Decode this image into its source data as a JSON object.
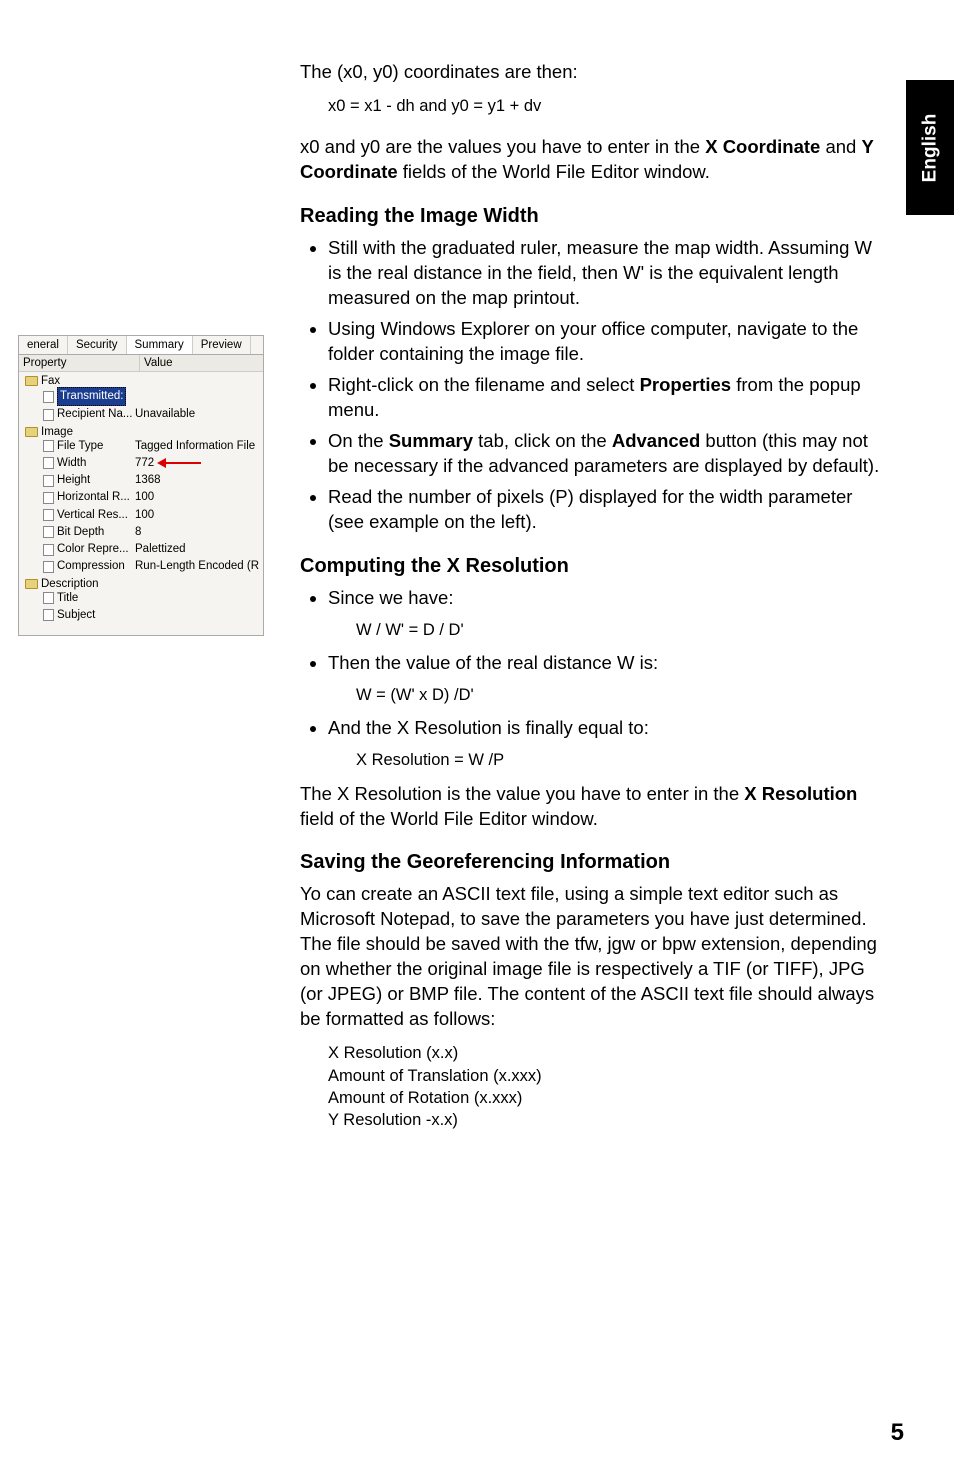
{
  "side_tab": "English",
  "intro": {
    "line1": "The (x0, y0) coordinates are then:",
    "formula": "x0 = x1 - dh and y0 = y1 + dv",
    "para2a": "x0 and y0 are the values you have to enter in the ",
    "para2b": "X Coordinate",
    "para2c": " and ",
    "para2d": "Y Coordinate",
    "para2e": " fields of the World File Editor window."
  },
  "reading": {
    "title": "Reading the Image Width",
    "b1": "Still with the graduated ruler, measure the map width. Assuming W is the real distance in the field, then W' is the equivalent length measured on the map printout.",
    "b2": "Using Windows Explorer on your office computer, navigate to the folder containing the image file.",
    "b3a": "Right-click on the filename and select ",
    "b3b": "Properties",
    "b3c": " from the popup menu.",
    "b4a": "On the ",
    "b4b": "Summary",
    "b4c": " tab, click on the ",
    "b4d": "Advanced",
    "b4e": " button (this may not be necessary if the advanced parameters are displayed by default).",
    "b5": "Read the number of pixels (P) displayed for the width parameter (see example on the left)."
  },
  "computing": {
    "title": "Computing the X Resolution",
    "b1": "Since we have:",
    "f1": "W / W' = D / D'",
    "b2": "Then the value of the real distance W is:",
    "f2": "W = (W' x D) /D'",
    "b3": "And the X Resolution is finally equal to:",
    "f3": "X Resolution = W /P",
    "para_a": "The X Resolution is the value you have to enter in the ",
    "para_b": "X Resolution",
    "para_c": " field of the World File Editor window."
  },
  "saving": {
    "title": "Saving the Georeferencing Information",
    "para": "Yo can create an ASCII text file, using a simple text editor such as Microsoft Notepad, to save the parameters you have just determined. The file should be saved with the tfw, jgw or bpw extension, depending on whether the original image file is respectively a TIF (or TIFF), JPG (or JPEG) or BMP file. The content of the ASCII text file should always be formatted as follows:",
    "l1": "X Resolution (x.x)",
    "l2": "Amount of Translation (x.xxx)",
    "l3": "Amount of Rotation (x.xxx)",
    "l4": "Y Resolution -x.x)"
  },
  "page_number": "5",
  "panel": {
    "tabs": [
      "eneral",
      "Security",
      "Summary",
      "Preview"
    ],
    "header": {
      "col1": "Property",
      "col2": "Value"
    },
    "groups": {
      "fax": {
        "label": "Fax",
        "items": [
          {
            "lbl": "Transmitted:",
            "val": "",
            "highlight": true
          },
          {
            "lbl": "Recipient Na...",
            "val": "Unavailable"
          }
        ]
      },
      "image": {
        "label": "Image",
        "items": [
          {
            "lbl": "File Type",
            "val": "Tagged Information File F"
          },
          {
            "lbl": "Width",
            "val": "772",
            "arrow": true
          },
          {
            "lbl": "Height",
            "val": "1368"
          },
          {
            "lbl": "Horizontal R...",
            "val": "100"
          },
          {
            "lbl": "Vertical Res...",
            "val": "100"
          },
          {
            "lbl": "Bit Depth",
            "val": "8"
          },
          {
            "lbl": "Color Repre...",
            "val": "Palettized"
          },
          {
            "lbl": "Compression",
            "val": "Run-Length Encoded (RLI"
          }
        ]
      },
      "description": {
        "label": "Description",
        "items": [
          {
            "lbl": "Title",
            "val": "",
            "pencil": true
          },
          {
            "lbl": "Subject",
            "val": "",
            "pencil": true
          }
        ]
      }
    }
  }
}
